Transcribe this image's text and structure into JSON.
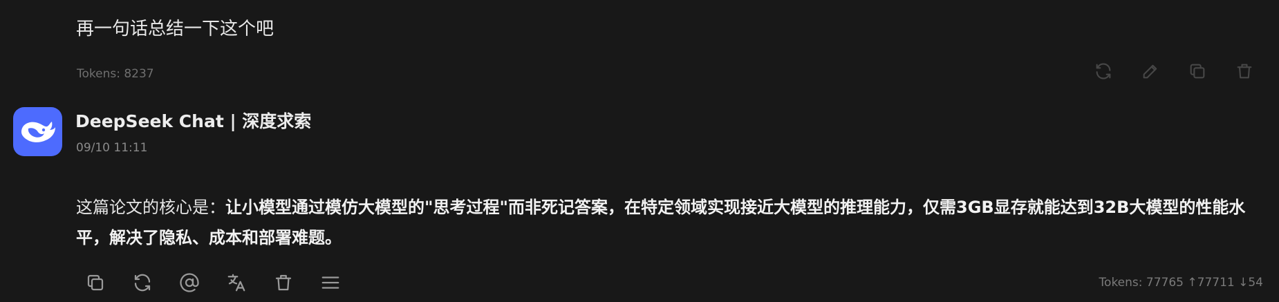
{
  "user_message": {
    "text": "再一句话总结一下这个吧",
    "tokens": "Tokens: 8237",
    "actions": [
      {
        "icon": "refresh-icon"
      },
      {
        "icon": "edit-icon"
      },
      {
        "icon": "copy-icon"
      },
      {
        "icon": "delete-icon"
      }
    ]
  },
  "assistant": {
    "name": "DeepSeek Chat | 深度求索",
    "timestamp": "09/10 11:11",
    "avatar_color": "#4d6bfe",
    "answer_lead": "这篇论文的核心是：",
    "answer_bold": "让小模型通过模仿大模型的\"思考过程\"而非死记答案，在特定领域实现接近大模型的推理能力，仅需3GB显存就能达到32B大模型的性能水平，解决了隐私、成本和部署难题。",
    "tokens": "Tokens: 77765 ↑77711 ↓54",
    "actions": [
      {
        "icon": "copy-icon"
      },
      {
        "icon": "regenerate-icon"
      },
      {
        "icon": "mention-icon"
      },
      {
        "icon": "translate-icon"
      },
      {
        "icon": "delete-icon"
      },
      {
        "icon": "menu-icon"
      }
    ]
  }
}
